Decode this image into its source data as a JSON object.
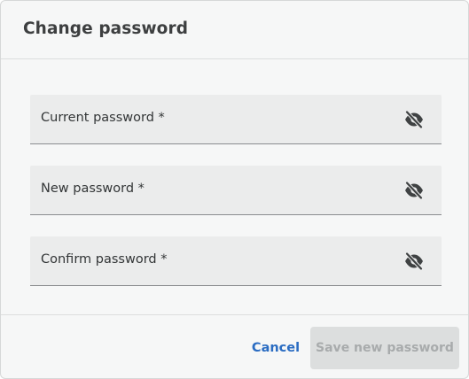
{
  "dialog": {
    "title": "Change password"
  },
  "fields": [
    {
      "label": "Current password *",
      "value": "",
      "visibility_icon": "eye-off-icon"
    },
    {
      "label": "New password *",
      "value": "",
      "visibility_icon": "eye-off-icon"
    },
    {
      "label": "Confirm password *",
      "value": "",
      "visibility_icon": "eye-off-icon"
    }
  ],
  "footer": {
    "cancel_label": "Cancel",
    "save_label": "Save new password",
    "save_enabled": false
  },
  "colors": {
    "accent": "#2a6cc2",
    "disabled_bg": "#dcdede",
    "disabled_text": "#a8abac",
    "field_bg": "#ebecec"
  }
}
